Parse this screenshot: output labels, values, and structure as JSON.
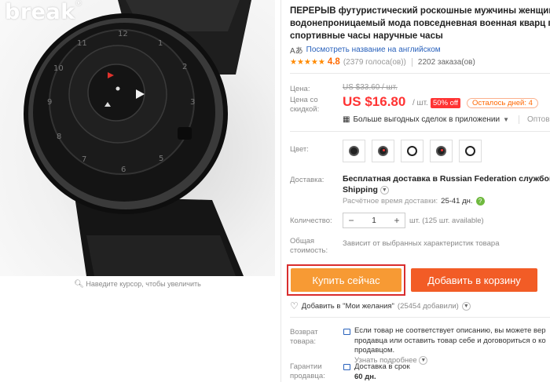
{
  "image": {
    "brand": "break",
    "brand_mark": "®",
    "zoom_hint": "Наведите курсор, чтобы увеличить"
  },
  "product": {
    "title_lines": [
      "ПЕРЕРЫВ футуристический роскошные мужчины женщины",
      "водонепроницаемый мода повседневная военная кварц го",
      "спортивные часы наручные часы"
    ],
    "translate_link": "Посмотреть название на английском",
    "rating": "4.8",
    "votes": "(2379 голоса(ов))",
    "orders": "2202 заказа(ов)",
    "stars": "★★★★★"
  },
  "price": {
    "label_price": "Цена:",
    "old_price": "US $33.60 / шт.",
    "label_discount_line1": "Цена со",
    "label_discount_line2": "скидкой:",
    "new_price": "US $16.80",
    "unit": "/ шт.",
    "off_badge": "50% off",
    "days_left": "Осталось дней: 4",
    "deals": "Больше выгодных сделок в приложении",
    "wholesale": "Оптова"
  },
  "options": {
    "color_label": "Цвет:",
    "color_swatches": [
      {
        "style": "black"
      },
      {
        "style": "black-red"
      },
      {
        "style": "white"
      },
      {
        "style": "black"
      },
      {
        "style": "white"
      }
    ]
  },
  "shipping": {
    "label": "Доставка:",
    "line1": "Бесплатная доставка в Russian Federation службой Al",
    "line2": "Shipping",
    "time_label": "Расчётное время доставки:",
    "time_value": "25-41 дн.",
    "help": "?"
  },
  "quantity": {
    "label": "Количество:",
    "minus": "−",
    "value": "1",
    "plus": "+",
    "available": "шт. (125 шт. available)"
  },
  "total": {
    "label_line1": "Общая",
    "label_line2": "стоимость:",
    "note": "Зависит от выбранных характеристик товара"
  },
  "actions": {
    "buy_now": "Купить сейчас",
    "add_to_cart": "Добавить в корзину",
    "wishlist": "Добавить в \"Мои желания\"",
    "wishlist_count": "(25454 добавили)"
  },
  "returns": {
    "label_line1": "Возврат",
    "label_line2": "товара:",
    "line1": "Если товар не соответствует описанию, вы можете вер",
    "line2": "продавца или оставить товар себе и договориться о ко",
    "line3": "продавцом.",
    "more": "Узнать подробнее"
  },
  "guarantee": {
    "label_line1": "Гарантии",
    "label_line2": "продавца:",
    "line1": "Доставка в срок",
    "line2": "60 дн."
  }
}
